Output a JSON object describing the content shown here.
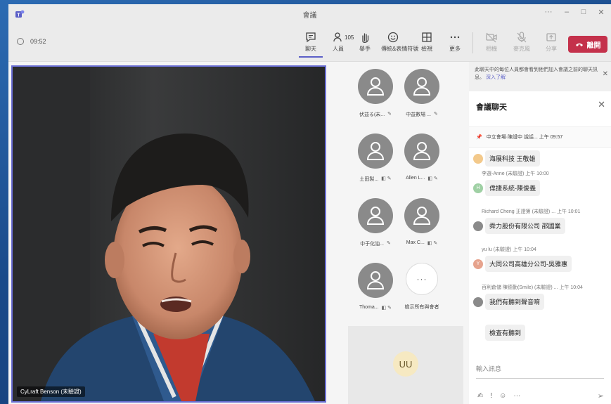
{
  "window": {
    "title": "會議",
    "min": "–",
    "max": "□",
    "close": "✕",
    "more": "···"
  },
  "toolbar": {
    "timer": "09:52",
    "chat_label": "聊天",
    "people_label": "人員",
    "people_count": "105",
    "raise_label": "舉手",
    "react_label": "傳統&表情符號",
    "view_label": "檢視",
    "more_label": "更多",
    "camera_label": "相機",
    "mic_label": "麥克風",
    "share_label": "分享",
    "leave_label": "離開"
  },
  "video": {
    "name": "CyLraft Benson (未驗證)"
  },
  "participants": [
    {
      "name": "伏益る(未...",
      "icons": "✎"
    },
    {
      "name": "中益數場 ...",
      "icons": "✎"
    },
    {
      "name": "土田製...",
      "icons": "◧ ✎"
    },
    {
      "name": "Allen L...",
      "icons": "◧ ✎"
    },
    {
      "name": "中于化油...",
      "icons": "✎"
    },
    {
      "name": "Max C...",
      "icons": "◧ ✎"
    },
    {
      "name": "Thoma...",
      "icons": "◧ ✎"
    },
    {
      "name": "檢示所有與會者",
      "icons": ""
    }
  ],
  "uu": {
    "initials": "UU"
  },
  "chat": {
    "notice": "此聊天中的每位人員都會看到他們加入會議之前的聊天訊息。",
    "notice_link": "深入了解",
    "title": "會議聊天",
    "pinned_text": "中立會場·陳證中  說話...  上午 09:57",
    "messages": [
      {
        "sender": "",
        "text": "海展科技 王敬雄",
        "avatar": "",
        "avatar_color": "#f3c98b"
      },
      {
        "sender": "李選-Anne (未驗證)  上午 10:00",
        "text": "偉捷系統-陳俊義",
        "avatar": "H",
        "avatar_color": "#9fd0a4"
      },
      {
        "sender": "Richard Cheng 正證第 (未驗證) ...  上午 10:01",
        "text": "舜力股份有限公司 邵國業",
        "avatar": "",
        "avatar_color": "#8a8a8a"
      },
      {
        "sender": "yu lu (未驗證)  上午 10:04",
        "text": "大同公司高雄分公司-吳雅惠",
        "avatar": "Y",
        "avatar_color": "#e6a38d"
      },
      {
        "sender": "百利倉儲 陳德勤(Smile) (未驗證) ...  上午 10:04",
        "text": "我們有聽到聲音唷",
        "avatar": "",
        "avatar_color": "#8a8a8a"
      },
      {
        "sender": "",
        "text": "檢查有聽到",
        "avatar": "",
        "avatar_color": ""
      }
    ],
    "compose_placeholder": "輸入訊息",
    "compose_tools": [
      "✍",
      "!",
      "☺",
      "···"
    ],
    "send": "➢"
  }
}
